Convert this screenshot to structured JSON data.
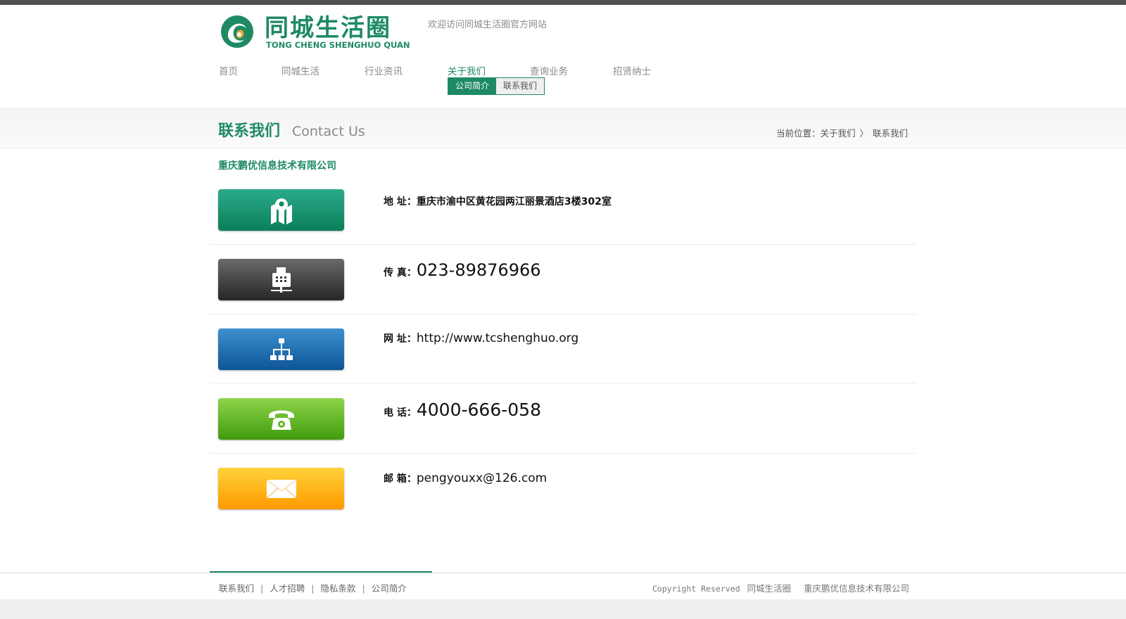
{
  "header": {
    "logo_cn": "同城生活圈",
    "logo_en": "TONG CHENG SHENGHUO QUAN",
    "welcome": "欢迎访问同城生活圈官方网站"
  },
  "nav": {
    "items": [
      {
        "label": "首页"
      },
      {
        "label": "同城生活"
      },
      {
        "label": "行业资讯"
      },
      {
        "label": "关于我们"
      },
      {
        "label": "查询业务"
      },
      {
        "label": "招贤纳士"
      }
    ],
    "active_index": 3,
    "sub": [
      {
        "label": "公司简介"
      },
      {
        "label": "联系我们"
      }
    ]
  },
  "page": {
    "title_cn": "联系我们",
    "title_en": "Contact Us",
    "breadcrumb_prefix": "当前位置：",
    "breadcrumb": [
      "关于我们",
      "联系我们"
    ],
    "company": "重庆鹏优信息技术有限公司"
  },
  "contacts": [
    {
      "label": "地 址：",
      "value": "重庆市渝中区黄花园两江丽景酒店3楼302室",
      "icon": "map-icon",
      "color": "#0b7e59"
    },
    {
      "label": "传 真：",
      "value": "023-89876966",
      "icon": "fax-icon",
      "color": "#333333"
    },
    {
      "label": "网 址：",
      "value": "http://www.tcshenghuo.org",
      "icon": "sitemap-icon",
      "color": "#1a6fb3"
    },
    {
      "label": "电 话：",
      "value": "4000-666-058",
      "icon": "phone-icon",
      "color": "#5ab51f"
    },
    {
      "label": "邮 箱：",
      "value": "pengyouxx@126.com",
      "icon": "mail-icon",
      "color": "#ffb400"
    }
  ],
  "footer": {
    "links": [
      "联系我们",
      "人才招聘",
      "隐私条款",
      "公司简介"
    ],
    "separator": "|",
    "copyright": "Copyright Reserved",
    "site": "同城生活圈",
    "company": "重庆鹏优信息技术有限公司"
  },
  "colors": {
    "brand_green": "#1e8a63",
    "nav_gray": "#8a8a8a"
  }
}
